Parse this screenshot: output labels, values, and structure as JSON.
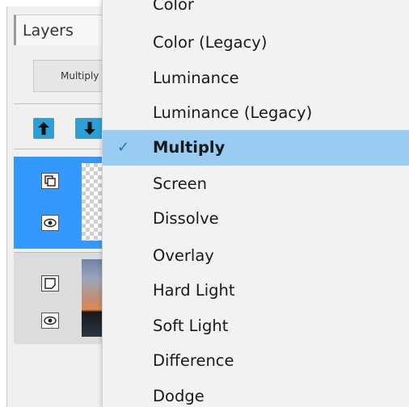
{
  "layers_panel": {
    "tab_label": "Layers",
    "blend_mode_value": "Multiply"
  },
  "blend_menu": {
    "items": [
      {
        "label": "Color",
        "selected": false
      },
      {
        "label": "Color (Legacy)",
        "selected": false
      },
      {
        "label": "Luminance",
        "selected": false
      },
      {
        "label": "Luminance (Legacy)",
        "selected": false
      },
      {
        "label": "Multiply",
        "selected": true
      },
      {
        "label": "Screen",
        "selected": false
      },
      {
        "label": "Dissolve",
        "selected": false
      },
      {
        "label": "Overlay",
        "selected": false
      },
      {
        "label": "Hard Light",
        "selected": false
      },
      {
        "label": "Soft Light",
        "selected": false
      },
      {
        "label": "Difference",
        "selected": false
      },
      {
        "label": "Dodge",
        "selected": false
      }
    ],
    "check_mark": "✓"
  },
  "colors": {
    "selected_row": "#99ccf3",
    "active_layer": "#3399ff",
    "tool_button": "#2aa0d8"
  }
}
